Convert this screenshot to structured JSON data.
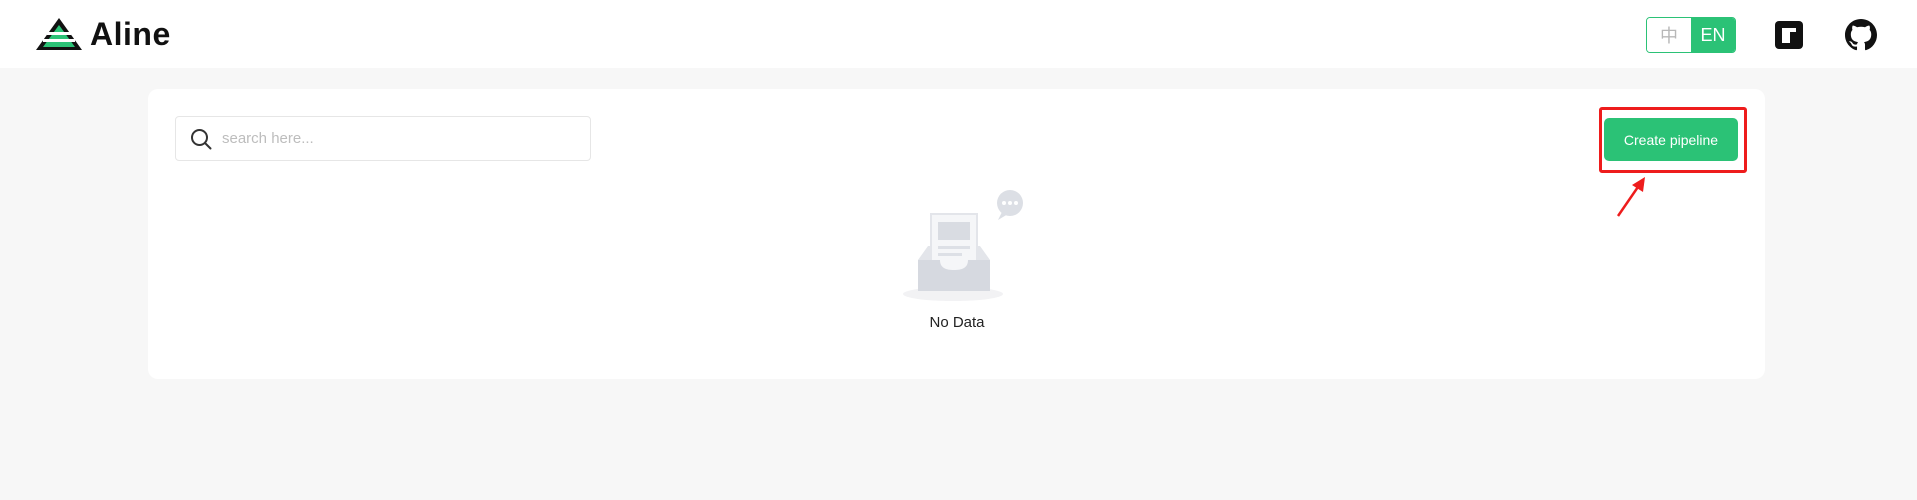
{
  "app": {
    "name": "Aline"
  },
  "header": {
    "lang_options": [
      "中",
      "EN"
    ],
    "lang_selected": "EN",
    "icons": [
      "notion-icon",
      "github-icon"
    ]
  },
  "search": {
    "placeholder": "search here..."
  },
  "toolbar": {
    "create_label": "Create pipeline"
  },
  "empty_state": {
    "text": "No Data"
  },
  "colors": {
    "accent": "#2bc276",
    "annotation": "#ee1c1c",
    "page_bg": "#f7f7f7"
  }
}
